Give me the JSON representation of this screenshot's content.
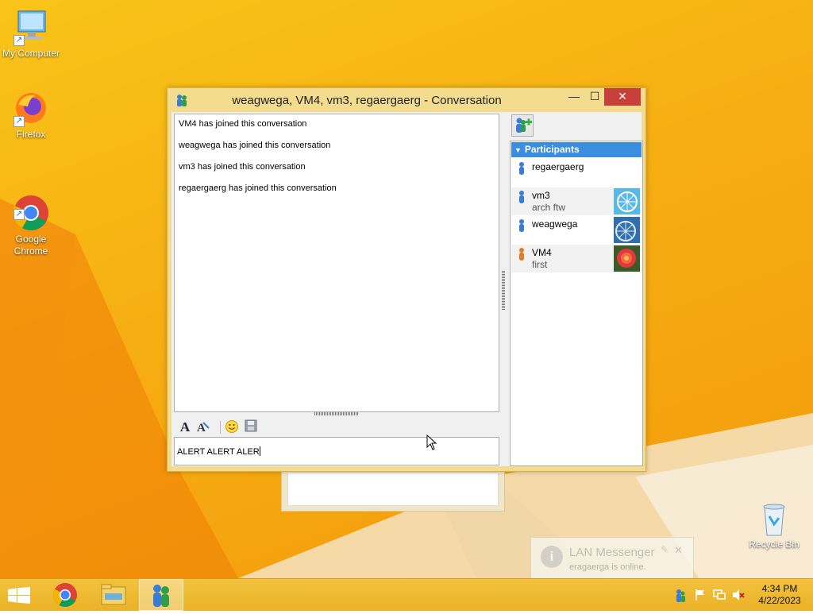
{
  "desktop": {
    "icons": [
      {
        "label": "My Computer"
      },
      {
        "label": "Firefox"
      },
      {
        "label": "Google\nChrome"
      },
      {
        "label": "Recycle Bin"
      }
    ]
  },
  "window": {
    "title": "weagwega, VM4, vm3, regaergaerg - Conversation",
    "controls": {
      "minimize": "—",
      "maximize": "☐",
      "close": "✕"
    },
    "messages": [
      "VM4 has joined this conversation",
      "weagwega has joined this conversation",
      "vm3 has joined this conversation",
      "regaergaerg has joined this conversation"
    ],
    "input_text": "ALERT ALERT ALER",
    "participants_header": "Participants",
    "participants": [
      {
        "name": "regaergaerg",
        "note": "",
        "status_color": "#3a7bd5"
      },
      {
        "name": "vm3",
        "note": "arch ftw",
        "status_color": "#3a7bd5"
      },
      {
        "name": "weagwega",
        "note": "",
        "status_color": "#3a7bd5"
      },
      {
        "name": "VM4",
        "note": "first",
        "status_color": "#e07b2a"
      }
    ]
  },
  "notification": {
    "title": "LAN Messenger",
    "message": "eragaerga is online."
  },
  "taskbar": {
    "time": "4:34 PM",
    "date": "4/22/2023"
  }
}
